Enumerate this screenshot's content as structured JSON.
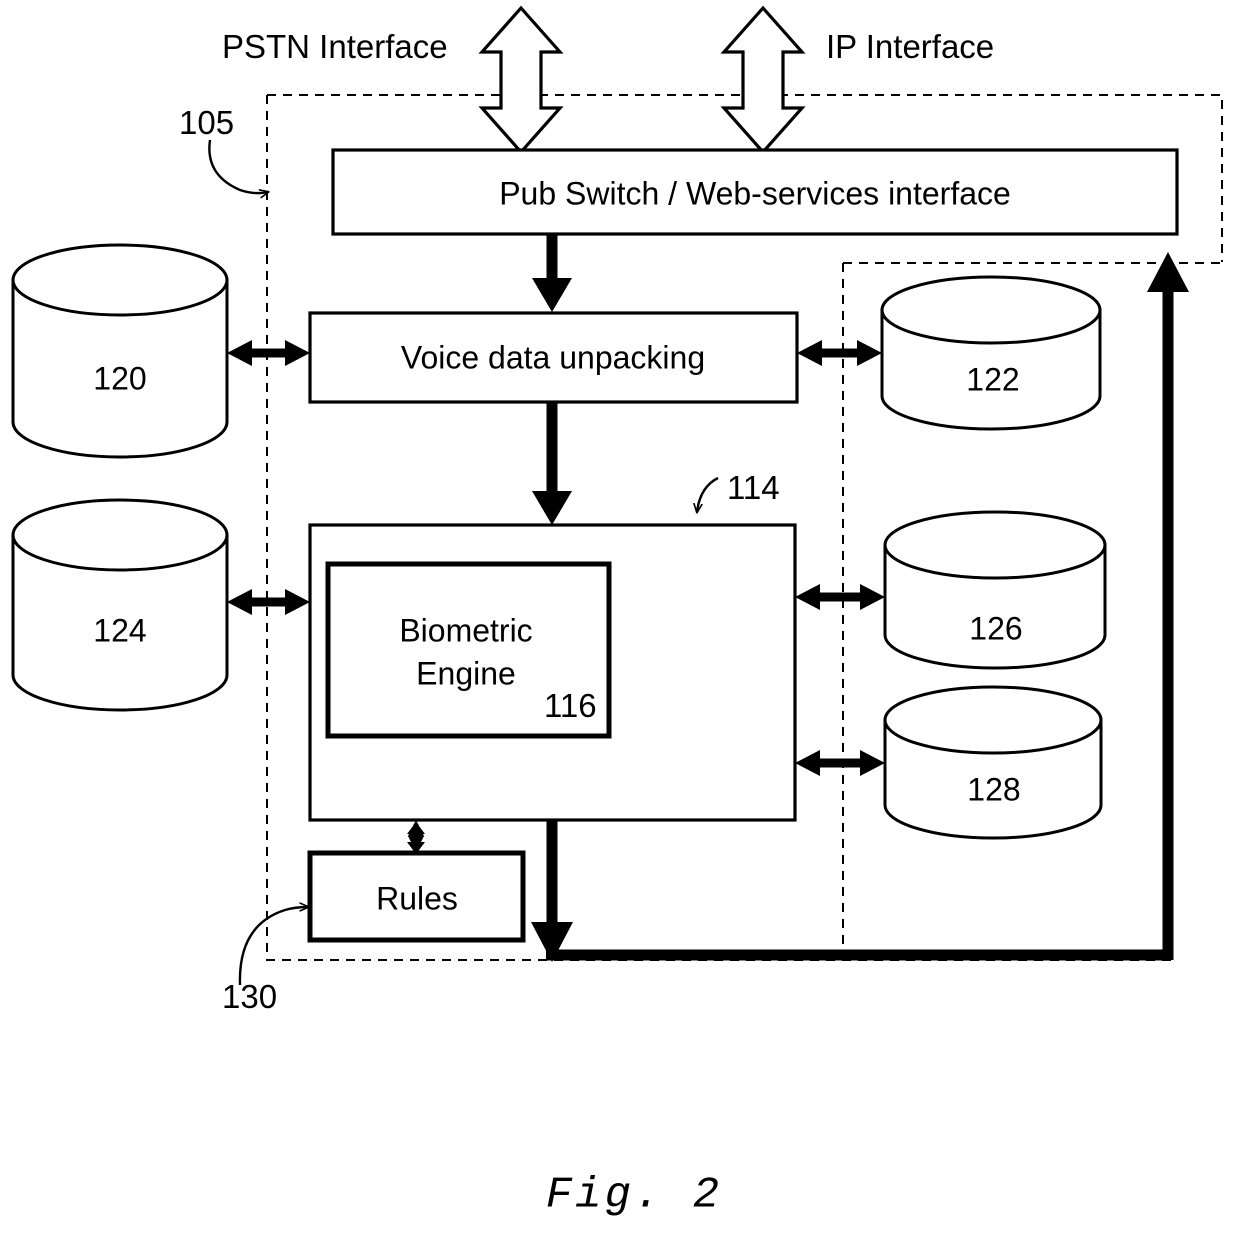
{
  "figure": {
    "caption": "Fig. 2",
    "interfaces": {
      "pstn": "PSTN Interface",
      "ip": "IP Interface"
    },
    "system_ref": "105",
    "rules_ref": "130",
    "engine_container_ref": "114",
    "engine_ref": "116",
    "boxes": [
      {
        "id": "pub-switch",
        "label": "Pub Switch / Web-services interface"
      },
      {
        "id": "voice-unpack",
        "label": "Voice data unpacking"
      },
      {
        "id": "biometric-engine",
        "label_line1": "Biometric",
        "label_line2": "Engine",
        "ref": "116"
      },
      {
        "id": "rules",
        "label": "Rules"
      }
    ],
    "databases": [
      {
        "id": "db-120",
        "label": "120",
        "side": "left"
      },
      {
        "id": "db-124",
        "label": "124",
        "side": "left"
      },
      {
        "id": "db-122",
        "label": "122",
        "side": "right"
      },
      {
        "id": "db-126",
        "label": "126",
        "side": "right"
      },
      {
        "id": "db-128",
        "label": "128",
        "side": "right"
      }
    ],
    "colors": {
      "stroke": "#000000",
      "fill": "#ffffff"
    }
  }
}
